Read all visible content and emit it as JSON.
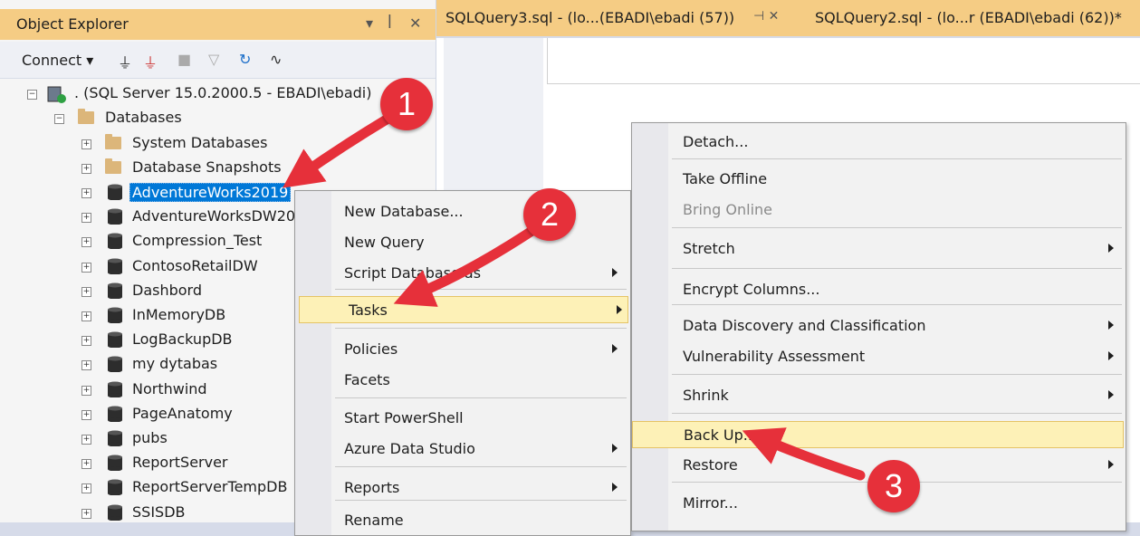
{
  "object_explorer": {
    "title": "Object Explorer",
    "title_controls": {
      "pin": "ꟾ",
      "dropdown": "▾",
      "close": "✕"
    },
    "toolbar": {
      "connect_label": "Connect ▾"
    },
    "server_node": ". (SQL Server 15.0.2000.5 - EBADI\\ebadi)",
    "databases_label": "Databases",
    "folders": [
      "System Databases",
      "Database Snapshots"
    ],
    "databases": [
      "AdventureWorks2019",
      "AdventureWorksDW20",
      "Compression_Test",
      "ContosoRetailDW",
      "Dashbord",
      "InMemoryDB",
      "LogBackupDB",
      "my dytabas",
      "Northwind",
      "PageAnatomy",
      "pubs",
      "ReportServer",
      "ReportServerTempDB",
      "SSISDB"
    ]
  },
  "tabs": {
    "tab1": "SQLQuery3.sql - (lo...(EBADI\\ebadi (57))",
    "tab1_icons": "⊣  ✕",
    "tab2": "SQLQuery2.sql - (lo...r (EBADI\\ebadi (62))*"
  },
  "context_menu_1": {
    "items": [
      "New Database...",
      "New Query",
      "Script Database as",
      "Tasks",
      "Policies",
      "Facets",
      "Start PowerShell",
      "Azure Data Studio",
      "Reports",
      "Rename"
    ]
  },
  "context_menu_2": {
    "items": [
      "Detach...",
      "Take Offline",
      "Bring Online",
      "Stretch",
      "Encrypt Columns...",
      "Data Discovery and Classification",
      "Vulnerability Assessment",
      "Shrink",
      "Back Up...",
      "Restore",
      "Mirror..."
    ]
  },
  "callouts": [
    "1",
    "2",
    "3"
  ],
  "colors": {
    "accent_title": "#f5cc84",
    "selection": "#0078d7",
    "highlight": "#fdf1b7",
    "callout": "#e6303a"
  }
}
